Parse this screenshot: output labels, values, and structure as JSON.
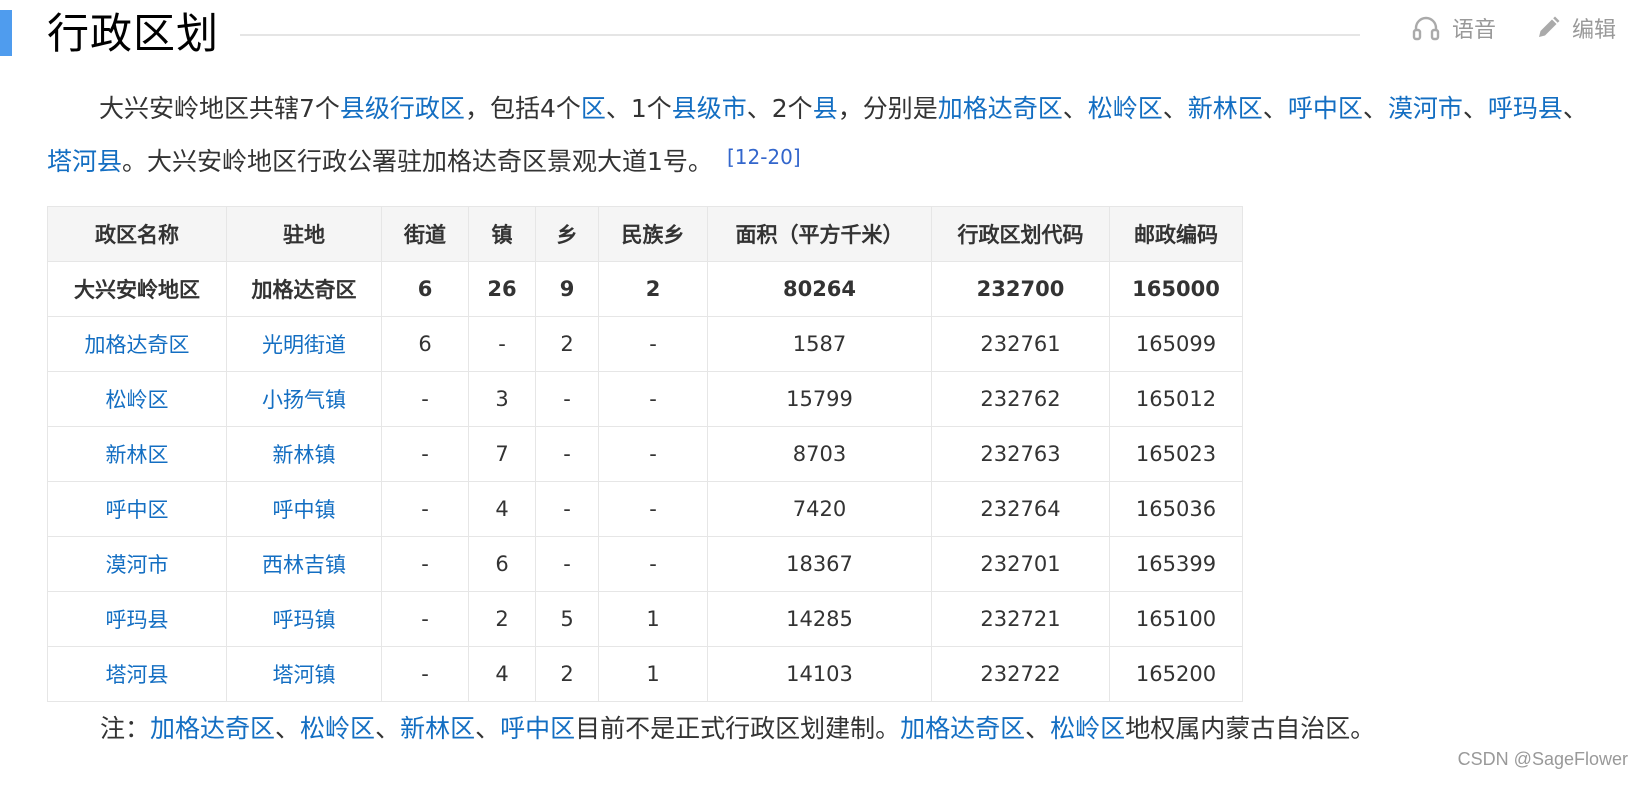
{
  "section": {
    "title": "行政区划",
    "voice_label": "语音",
    "edit_label": "编辑"
  },
  "intro": {
    "t1": "大兴安岭地区共辖7个",
    "l1": "县级行政区",
    "t2": "，包括4个",
    "l2": "区",
    "t3": "、1个",
    "l3": "县级市",
    "t4": "、2个",
    "l4": "县",
    "t5": "，分别是",
    "l5": "加格达奇区",
    "t6": "、",
    "l6": "松岭区",
    "t7": "、",
    "l7": "新林区",
    "t8": "、",
    "l8": "呼中区",
    "t9": "、",
    "l9": "漠河市",
    "t10": "、",
    "l10": "呼玛县",
    "t11": "、",
    "l11": "塔河县",
    "t12": "。大兴安岭地区行政公署驻加格达奇区景观大道1号。",
    "ref": "[12-20]"
  },
  "table": {
    "headers": [
      "政区名称",
      "驻地",
      "街道",
      "镇",
      "乡",
      "民族乡",
      "面积（平方千米）",
      "行政区划代码",
      "邮政编码"
    ],
    "rows": [
      [
        "大兴安岭地区",
        "加格达奇区",
        "6",
        "26",
        "9",
        "2",
        "80264",
        "232700",
        "165000"
      ],
      [
        "加格达奇区",
        "光明街道",
        "6",
        "-",
        "2",
        "-",
        "1587",
        "232761",
        "165099"
      ],
      [
        "松岭区",
        "小扬气镇",
        "-",
        "3",
        "-",
        "-",
        "15799",
        "232762",
        "165012"
      ],
      [
        "新林区",
        "新林镇",
        "-",
        "7",
        "-",
        "-",
        "8703",
        "232763",
        "165023"
      ],
      [
        "呼中区",
        "呼中镇",
        "-",
        "4",
        "-",
        "-",
        "7420",
        "232764",
        "165036"
      ],
      [
        "漠河市",
        "西林吉镇",
        "-",
        "6",
        "-",
        "-",
        "18367",
        "232701",
        "165399"
      ],
      [
        "呼玛县",
        "呼玛镇",
        "-",
        "2",
        "5",
        "1",
        "14285",
        "232721",
        "165100"
      ],
      [
        "塔河县",
        "塔河镇",
        "-",
        "4",
        "2",
        "1",
        "14103",
        "232722",
        "165200"
      ]
    ]
  },
  "note": {
    "t1": "注：",
    "l1": "加格达奇区",
    "t2": "、",
    "l2": "松岭区",
    "t3": "、",
    "l3": "新林区",
    "t4": "、",
    "l4": "呼中区",
    "t5": "目前不是正式行政区划建制。",
    "l5": "加格达奇区",
    "t6": "、",
    "l6": "松岭区",
    "t7": "地权属内蒙古自治区。"
  },
  "watermark": "CSDN @SageFlower",
  "colors": {
    "link": "#136ec2",
    "accent": "#4f9cee",
    "header_bg": "#f5f5f5"
  }
}
